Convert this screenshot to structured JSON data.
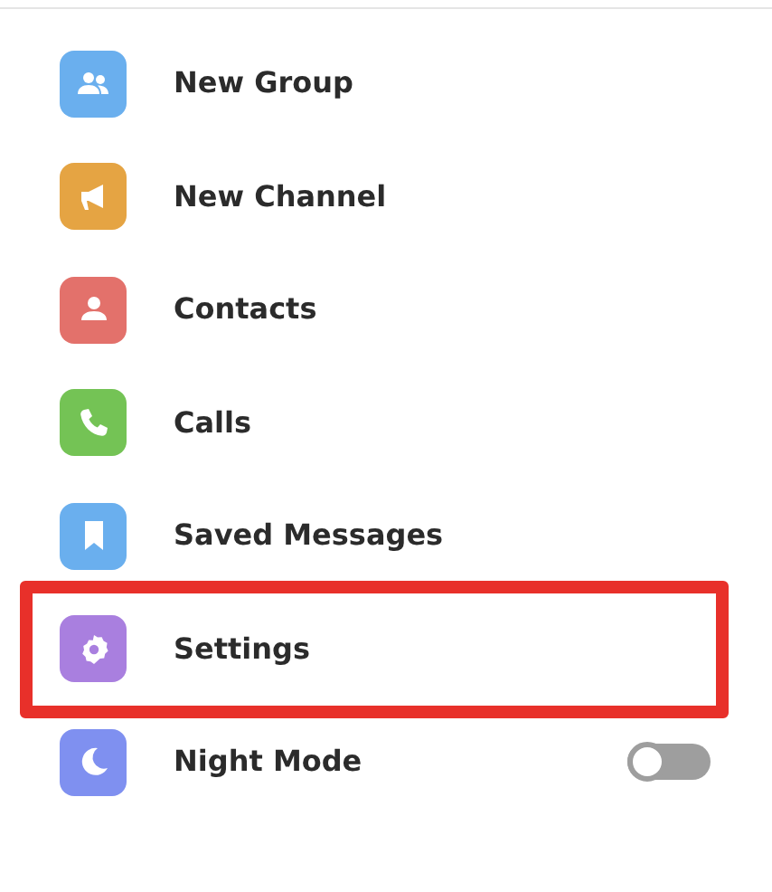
{
  "menu": [
    {
      "kind": "group",
      "label": "New Group",
      "color": "#6aafee",
      "highlighted": false
    },
    {
      "kind": "channel",
      "label": "New Channel",
      "color": "#e5a443",
      "highlighted": false
    },
    {
      "kind": "contacts",
      "label": "Contacts",
      "color": "#e3716b",
      "highlighted": false
    },
    {
      "kind": "calls",
      "label": "Calls",
      "color": "#74c355",
      "highlighted": false
    },
    {
      "kind": "saved",
      "label": "Saved Messages",
      "color": "#6aafee",
      "highlighted": false
    },
    {
      "kind": "settings",
      "label": "Settings",
      "color": "#a97fdf",
      "highlighted": true
    },
    {
      "kind": "night",
      "label": "Night Mode",
      "color": "#7f90f0",
      "highlighted": false,
      "on": false
    }
  ]
}
